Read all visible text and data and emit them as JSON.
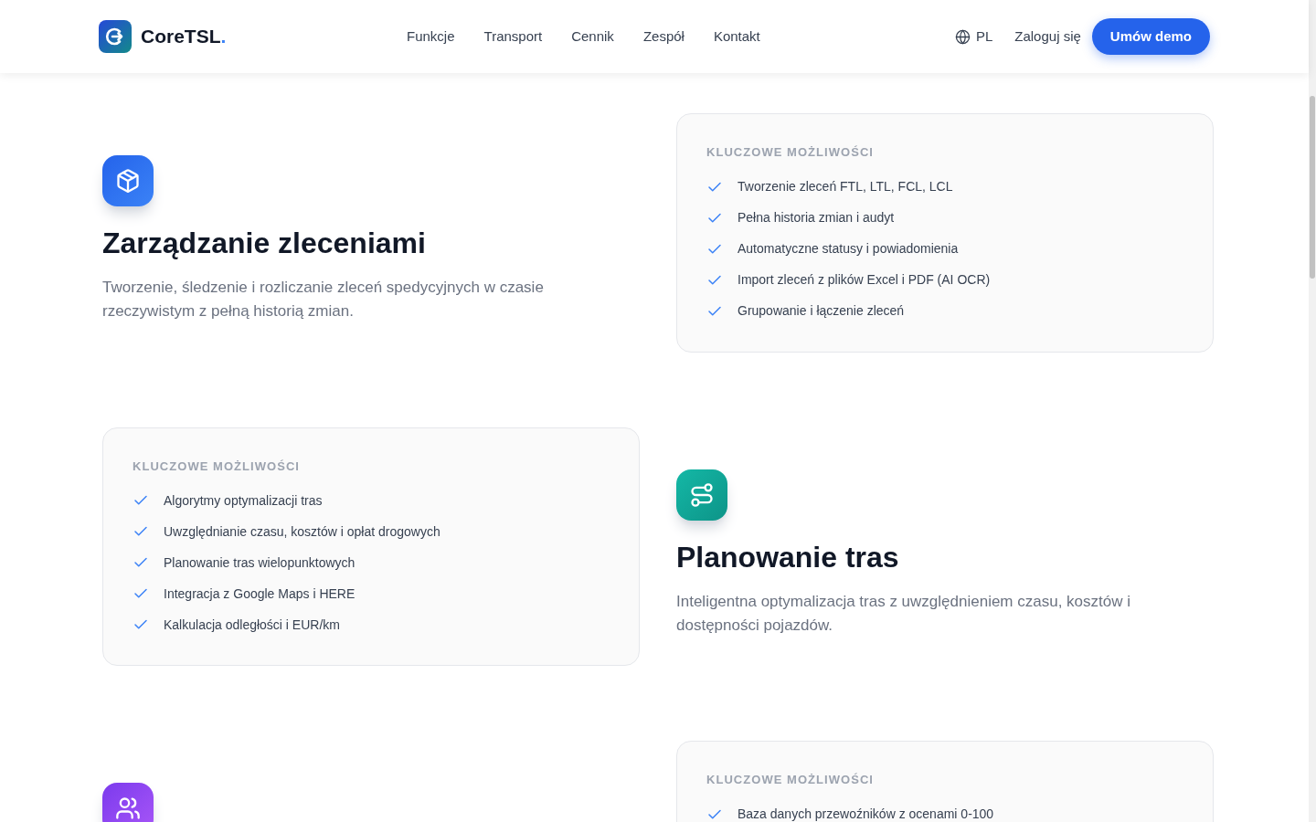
{
  "header": {
    "brand": "CoreTSL",
    "brand_dot": ".",
    "nav": [
      "Funkcje",
      "Transport",
      "Cennik",
      "Zespół",
      "Kontakt"
    ],
    "language": "PL",
    "login": "Zaloguj się",
    "cta": "Umów demo"
  },
  "features": [
    {
      "kind": "box",
      "mirrored": false,
      "title": "Zarządzanie zleceniami",
      "description": "Tworzenie, śledzenie i rozliczanie zleceń spedycyjnych w czasie rzeczywistym z pełną historią zmian.",
      "card": {
        "heading": "KLUCZOWE MOŻLIWOŚCI",
        "items": [
          "Tworzenie zleceń FTL, LTL, FCL, LCL",
          "Pełna historia zmian i audyt",
          "Automatyczne statusy i powiadomienia",
          "Import zleceń z plików Excel i PDF (AI OCR)",
          "Grupowanie i łączenie zleceń"
        ]
      }
    },
    {
      "kind": "route",
      "mirrored": true,
      "title": "Planowanie tras",
      "description": "Inteligentna optymalizacja tras z uwzględnieniem czasu, kosztów i dostępności pojazdów.",
      "card": {
        "heading": "KLUCZOWE MOŻLIWOŚCI",
        "items": [
          "Algorytmy optymalizacji tras",
          "Uwzględnianie czasu, kosztów i opłat drogowych",
          "Planowanie tras wielopunktowych",
          "Integracja z Google Maps i HERE",
          "Kalkulacja odległości i EUR/km"
        ]
      }
    },
    {
      "kind": "users",
      "mirrored": false,
      "card": {
        "heading": "KLUCZOWE MOŻLIWOŚCI",
        "items": [
          "Baza danych przewoźników z ocenami 0-100"
        ]
      }
    }
  ]
}
